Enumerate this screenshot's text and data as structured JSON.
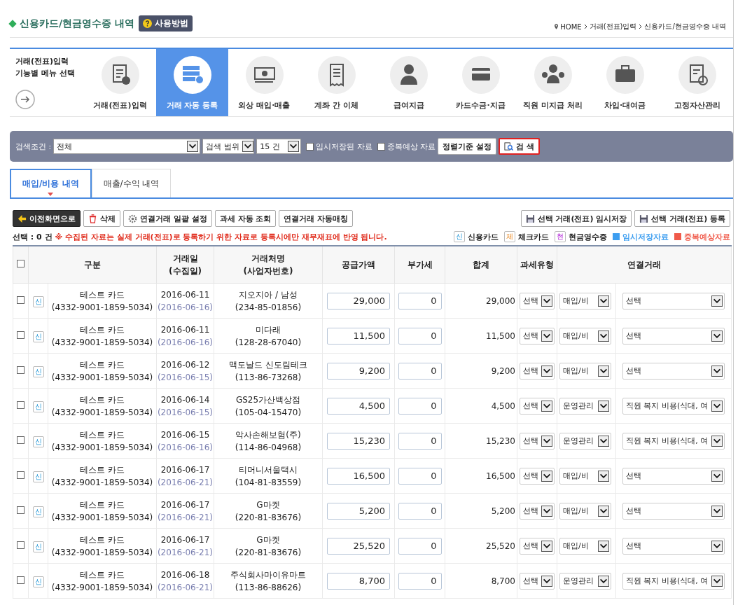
{
  "header": {
    "title": "신용카드/현금영수증 내역",
    "help_button": "사용방법",
    "breadcrumb": [
      "HOME",
      "거래(전표)입력",
      "신용카드/현금영수증 내역"
    ]
  },
  "menu": {
    "intro": [
      "거래(전표)입력",
      "기능별 메뉴 선택"
    ],
    "items": [
      {
        "label": "거래(전표)입력",
        "selected": false
      },
      {
        "label": "거래 자동 등록",
        "selected": true
      },
      {
        "label": "외상 매입·매출",
        "selected": false
      },
      {
        "label": "계좌 간 이체",
        "selected": false
      },
      {
        "label": "급여지급",
        "selected": false
      },
      {
        "label": "카드수금·지급",
        "selected": false
      },
      {
        "label": "직원 미지급 처리",
        "selected": false
      },
      {
        "label": "차입·대여금",
        "selected": false
      },
      {
        "label": "고정자산관리",
        "selected": false
      }
    ]
  },
  "search": {
    "label": "검색조건 :",
    "condition": "전체",
    "range": "검색 범위",
    "count": "15 건",
    "options": [
      {
        "label": "임시저장된 자료",
        "checked": false
      },
      {
        "label": "중복예상 자료",
        "checked": false
      }
    ],
    "sort_button": "정렬기준 설정",
    "search_button": "검 색"
  },
  "tabs": [
    {
      "label": "매입/비용 내역",
      "selected": true
    },
    {
      "label": "매출/수익 내역",
      "selected": false
    }
  ],
  "toolbar": {
    "left": [
      {
        "label": "이전화면으로",
        "kind": "back"
      },
      {
        "label": "삭제",
        "kind": "delete"
      },
      {
        "label": "연결거래 일괄 설정",
        "kind": "settings"
      },
      {
        "label": "과세 자동 조회",
        "kind": "plain"
      },
      {
        "label": "연결거래 자동매칭",
        "kind": "plain"
      }
    ],
    "right": [
      {
        "label": "선택 거래(전표) 임시저장",
        "kind": "save"
      },
      {
        "label": "선택 거래(전표) 등록",
        "kind": "save"
      }
    ]
  },
  "info": {
    "selection": "선택 : 0 건",
    "notice": "※ 수집된 자료는 실제 거래(전표)로 등록하기 위한 자료로 등록시에만 재무재표에 반영 됩니다."
  },
  "legend": [
    {
      "kind": "credit",
      "badge": "신",
      "label": "신용카드"
    },
    {
      "kind": "check",
      "badge": "체",
      "label": "체크카드"
    },
    {
      "kind": "cash",
      "badge": "현",
      "label": "현금영수증"
    },
    {
      "kind": "swatch",
      "label": "임시저장자료",
      "color": "#3d9ef0"
    },
    {
      "kind": "swatch",
      "label": "중복예상자료",
      "color": "#f05a4a"
    }
  ],
  "table": {
    "columns": [
      [
        "구분"
      ],
      [
        "거래일",
        "(수집일)"
      ],
      [
        "거래처명",
        "(사업자번호)"
      ],
      [
        "공급가액"
      ],
      [
        "부가세"
      ],
      [
        "합계"
      ],
      [
        "과세유형"
      ],
      [
        "연결거래"
      ]
    ],
    "all_checked": false,
    "rows": [
      {
        "checked": false,
        "kind": "credit",
        "badge": "신",
        "card": "테스트 카드",
        "card_no": "(4332-9001-1859-5034)",
        "date": "2016-06-11",
        "collected": "(2016-06-16)",
        "vendor": "지오지아 / 남성",
        "biz_no": "(234-85-01856)",
        "supply": "29,000",
        "vat": "0",
        "total": "29,000",
        "tax_type": "선택",
        "category": "매입/비",
        "link": "선택"
      },
      {
        "checked": false,
        "kind": "credit",
        "badge": "신",
        "card": "테스트 카드",
        "card_no": "(4332-9001-1859-5034)",
        "date": "2016-06-11",
        "collected": "(2016-06-16)",
        "vendor": "미다래",
        "biz_no": "(128-28-67040)",
        "supply": "11,500",
        "vat": "0",
        "total": "11,500",
        "tax_type": "선택",
        "category": "매입/비",
        "link": "선택"
      },
      {
        "checked": false,
        "kind": "credit",
        "badge": "신",
        "card": "테스트 카드",
        "card_no": "(4332-9001-1859-5034)",
        "date": "2016-06-12",
        "collected": "(2016-06-15)",
        "vendor": "맥도날드 신도림테크",
        "biz_no": "(113-86-73268)",
        "supply": "9,200",
        "vat": "0",
        "total": "9,200",
        "tax_type": "선택",
        "category": "매입/비",
        "link": "선택"
      },
      {
        "checked": false,
        "kind": "credit",
        "badge": "신",
        "card": "테스트 카드",
        "card_no": "(4332-9001-1859-5034)",
        "date": "2016-06-14",
        "collected": "(2016-06-15)",
        "vendor": "GS25가산백상점",
        "biz_no": "(105-04-15470)",
        "supply": "4,500",
        "vat": "0",
        "total": "4,500",
        "tax_type": "선택",
        "category": "운영관리",
        "link": "직원 복지 비용(식대, 여"
      },
      {
        "checked": false,
        "kind": "credit",
        "badge": "신",
        "card": "테스트 카드",
        "card_no": "(4332-9001-1859-5034)",
        "date": "2016-06-15",
        "collected": "(2016-06-16)",
        "vendor": "악사손해보험(주)",
        "biz_no": "(114-86-04968)",
        "supply": "15,230",
        "vat": "0",
        "total": "15,230",
        "tax_type": "선택",
        "category": "운영관리",
        "link": "직원 복지 비용(식대, 여"
      },
      {
        "checked": false,
        "kind": "credit",
        "badge": "신",
        "card": "테스트 카드",
        "card_no": "(4332-9001-1859-5034)",
        "date": "2016-06-17",
        "collected": "(2016-06-21)",
        "vendor": "티머니서울택시",
        "biz_no": "(104-81-83559)",
        "supply": "16,500",
        "vat": "0",
        "total": "16,500",
        "tax_type": "선택",
        "category": "매입/비",
        "link": "선택"
      },
      {
        "checked": false,
        "kind": "credit",
        "badge": "신",
        "card": "테스트 카드",
        "card_no": "(4332-9001-1859-5034)",
        "date": "2016-06-17",
        "collected": "(2016-06-21)",
        "vendor": "G마켓",
        "biz_no": "(220-81-83676)",
        "supply": "5,200",
        "vat": "0",
        "total": "5,200",
        "tax_type": "선택",
        "category": "매입/비",
        "link": "선택"
      },
      {
        "checked": false,
        "kind": "credit",
        "badge": "신",
        "card": "테스트 카드",
        "card_no": "(4332-9001-1859-5034)",
        "date": "2016-06-17",
        "collected": "(2016-06-21)",
        "vendor": "G마켓",
        "biz_no": "(220-81-83676)",
        "supply": "25,520",
        "vat": "0",
        "total": "25,520",
        "tax_type": "선택",
        "category": "매입/비",
        "link": "선택"
      },
      {
        "checked": false,
        "kind": "credit",
        "badge": "신",
        "card": "테스트 카드",
        "card_no": "(4332-9001-1859-5034)",
        "date": "2016-06-18",
        "collected": "(2016-06-21)",
        "vendor": "주식회사마이유마트",
        "biz_no": "(113-86-88626)",
        "supply": "8,700",
        "vat": "0",
        "total": "8,700",
        "tax_type": "선택",
        "category": "운영관리",
        "link": "직원 복지 비용(식대, 여"
      }
    ]
  }
}
